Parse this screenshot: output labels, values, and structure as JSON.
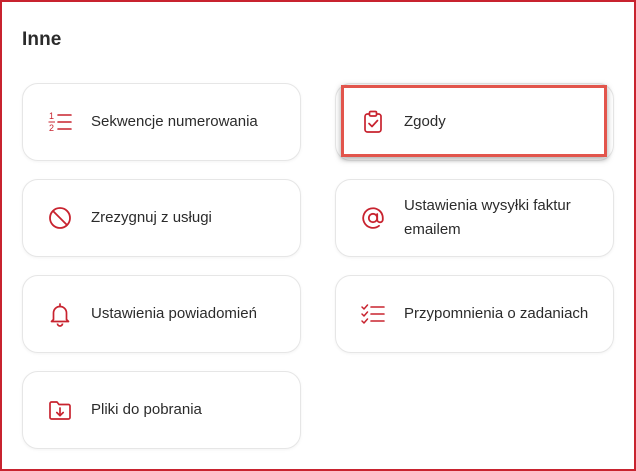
{
  "section": {
    "title": "Inne"
  },
  "cards": [
    {
      "label": "Sekwencje numerowania",
      "icon": "numbered-list-icon"
    },
    {
      "label": "Zgody",
      "icon": "clipboard-check-icon"
    },
    {
      "label": "Zrezygnuj z usługi",
      "icon": "prohibited-icon"
    },
    {
      "label": "Ustawienia wysyłki faktur emailem",
      "icon": "at-sign-icon"
    },
    {
      "label": "Ustawienia powiadomień",
      "icon": "bell-icon"
    },
    {
      "label": "Przypomnienia o zadaniach",
      "icon": "checklist-icon"
    },
    {
      "label": "Pliki do pobrania",
      "icon": "folder-download-icon"
    }
  ],
  "colors": {
    "accent": "#c8232f",
    "highlight_border": "#e2554c",
    "card_border": "#e6e6e6",
    "text": "#2b2b2b"
  }
}
